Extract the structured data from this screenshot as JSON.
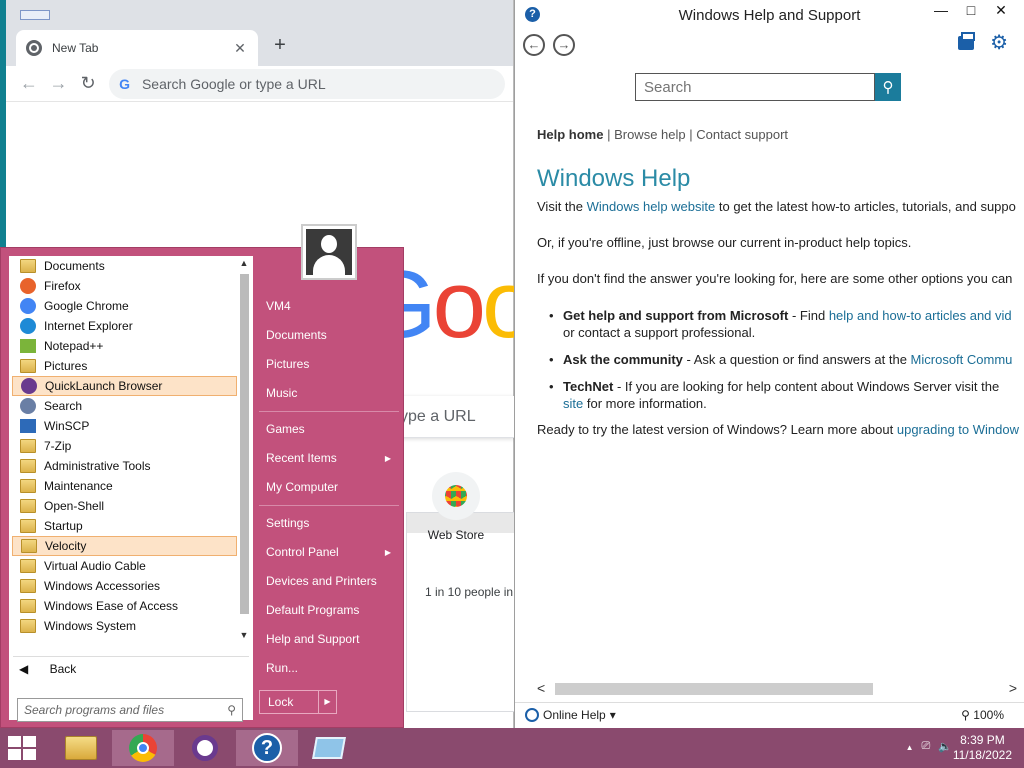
{
  "chrome": {
    "tab_title": "New Tab",
    "tab_close": "✕",
    "new_tab": "+",
    "back": "←",
    "forward": "→",
    "reload": "↻",
    "omnibox_icon": "G",
    "omnibox_placeholder": "Search Google or type a URL",
    "logo_letters": [
      "G",
      "o",
      "o"
    ],
    "ntp_search_partial": "ype a URL",
    "shortcut_label": "Web Store",
    "snippet": "1 in 10 people in"
  },
  "help": {
    "title": "Windows Help and Support",
    "title_icon": "?",
    "window_buttons": [
      "—",
      "□",
      "✕"
    ],
    "back": "←",
    "forward": "→",
    "search_placeholder": "Search",
    "links": {
      "home": "Help home",
      "sep1": " | ",
      "browse": "Browse help",
      "sep2": " | ",
      "contact": "Contact support"
    },
    "heading": "Windows Help",
    "p1_a": "Visit the ",
    "p1_link": "Windows help website",
    "p1_b": " to get the latest how-to articles, tutorials, and suppo",
    "p2": "Or, if you're offline, just browse our current in-product help topics.",
    "p3": "If you don't find the answer you're looking for, here are some other options you can",
    "bullet1_bold": "Get help and support from Microsoft",
    "bullet1_a": " - Find ",
    "bullet1_link": "help and how-to articles and vid",
    "bullet1_line2": "or contact a support professional.",
    "bullet2_bold": "Ask the community",
    "bullet2_a": " - Ask a question or find answers at the ",
    "bullet2_link": "Microsoft Commu",
    "bullet3_bold": "TechNet",
    "bullet3_a": " - If you are looking for help content about Windows Server visit the",
    "bullet3_link": "site",
    "bullet3_b": " for more information.",
    "p4_a": "Ready to try the latest version of Windows? Learn more about ",
    "p4_link": "upgrading to Window",
    "online_help": "Online Help",
    "online_help_arrow": "▾",
    "zoom": "100%",
    "zoom_icon": "⚲",
    "scroll_left": "<",
    "scroll_right": ">",
    "search_icon": "⚲"
  },
  "startmenu": {
    "programs": [
      {
        "label": "Documents",
        "icon": "folder",
        "highlight": false
      },
      {
        "label": "Firefox",
        "icon": "round",
        "color": "#e8632b",
        "highlight": false
      },
      {
        "label": "Google Chrome",
        "icon": "round",
        "color": "#4285f4",
        "highlight": false
      },
      {
        "label": "Internet Explorer",
        "icon": "round",
        "color": "#1e8ad6",
        "highlight": false
      },
      {
        "label": "Notepad++",
        "icon": "notepad",
        "color": "#7bb43a",
        "highlight": false
      },
      {
        "label": "Pictures",
        "icon": "folder",
        "highlight": false
      },
      {
        "label": "QuickLaunch Browser",
        "icon": "round",
        "color": "#6a3a8e",
        "highlight": true
      },
      {
        "label": "Search",
        "icon": "search",
        "color": "#6a7fa5",
        "highlight": false
      },
      {
        "label": "WinSCP",
        "icon": "winscp",
        "color": "#2d6ab8",
        "highlight": false
      },
      {
        "label": "7-Zip",
        "icon": "folder",
        "highlight": false
      },
      {
        "label": "Administrative Tools",
        "icon": "folder",
        "highlight": false
      },
      {
        "label": "Maintenance",
        "icon": "folder",
        "highlight": false
      },
      {
        "label": "Open-Shell",
        "icon": "folder",
        "highlight": false
      },
      {
        "label": "Startup",
        "icon": "folder",
        "highlight": false
      },
      {
        "label": "Velocity",
        "icon": "folder",
        "highlight": true
      },
      {
        "label": "Virtual Audio Cable",
        "icon": "folder",
        "highlight": false
      },
      {
        "label": "Windows Accessories",
        "icon": "folder",
        "highlight": false
      },
      {
        "label": "Windows Ease of Access",
        "icon": "folder",
        "highlight": false
      },
      {
        "label": "Windows System",
        "icon": "folder",
        "highlight": false
      }
    ],
    "scroll_up": "▲",
    "scroll_down": "▼",
    "back_arrow": "◀",
    "back_label": "Back",
    "search_placeholder": "Search programs and files",
    "search_icon": "⚲",
    "right_items": [
      {
        "label": "VM4",
        "arrow": false,
        "sep_after": false
      },
      {
        "label": "Documents",
        "arrow": false,
        "sep_after": false
      },
      {
        "label": "Pictures",
        "arrow": false,
        "sep_after": false
      },
      {
        "label": "Music",
        "arrow": false,
        "sep_after": true
      },
      {
        "label": "Games",
        "arrow": false,
        "sep_after": false
      },
      {
        "label": "Recent Items",
        "arrow": true,
        "sep_after": false
      },
      {
        "label": "My Computer",
        "arrow": false,
        "sep_after": true
      },
      {
        "label": "Settings",
        "arrow": false,
        "sep_after": false
      },
      {
        "label": "Control Panel",
        "arrow": true,
        "sep_after": false
      },
      {
        "label": "Devices and Printers",
        "arrow": false,
        "sep_after": false
      },
      {
        "label": "Default Programs",
        "arrow": false,
        "sep_after": false
      },
      {
        "label": "Help and Support",
        "arrow": false,
        "sep_after": false
      },
      {
        "label": "Run...",
        "arrow": false,
        "sep_after": false
      }
    ],
    "submenu_arrow": "▶",
    "lock_label": "Lock",
    "lock_arrow": "▶"
  },
  "taskbar": {
    "apps": [
      {
        "name": "file-explorer",
        "active": false
      },
      {
        "name": "chrome",
        "active": true
      },
      {
        "name": "quicklaunch-browser",
        "active": false
      },
      {
        "name": "help-and-support",
        "active": true
      },
      {
        "name": "virtual-desktop",
        "active": false
      }
    ],
    "help_glyph": "?",
    "tray_up": "▲",
    "tray_network": "⎚",
    "tray_volume": "🔈",
    "time": "8:39 PM",
    "date": "11/18/2022"
  }
}
